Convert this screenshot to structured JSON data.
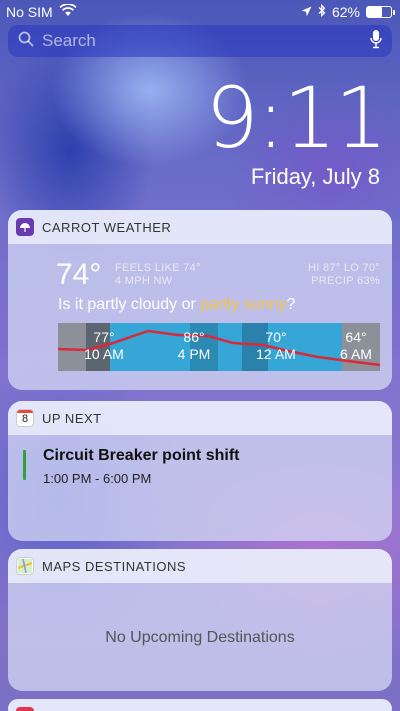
{
  "status_bar": {
    "carrier": "No SIM",
    "battery": "62%",
    "battery_level": 0.62
  },
  "search": {
    "placeholder": "Search"
  },
  "clock": {
    "time": "9:11",
    "date": "Friday, July 8"
  },
  "carrot_weather": {
    "title": "CARROT WEATHER",
    "temp": "74°",
    "feels_like": "FEELS LIKE 74°",
    "wind": "4 MPH NW",
    "hi_lo": "HI 87° LO 70°",
    "precip": "PRECIP 63%",
    "quip_prefix": "Is it partly cloudy or ",
    "quip_highlight": "partly sunny",
    "quip_suffix": "?",
    "timeline": [
      {
        "temp": "77°",
        "time": "10 AM"
      },
      {
        "temp": "86°",
        "time": "4 PM"
      },
      {
        "temp": "70°",
        "time": "12 AM"
      },
      {
        "temp": "64°",
        "time": "6 AM"
      }
    ],
    "colors": {
      "sky": "#35a6d6",
      "cloud": "#8a8f99",
      "night": "#2a7fa8",
      "line": "#d9293b",
      "highlight": "#f6c743"
    }
  },
  "up_next": {
    "title": "UP NEXT",
    "calendar_day": "8",
    "event_title": "Circuit Breaker point shift",
    "event_time": "1:00 PM - 6:00 PM",
    "event_color": "#2fa23c"
  },
  "maps_destinations": {
    "title": "MAPS DESTINATIONS",
    "empty_text": "No Upcoming Destinations"
  }
}
